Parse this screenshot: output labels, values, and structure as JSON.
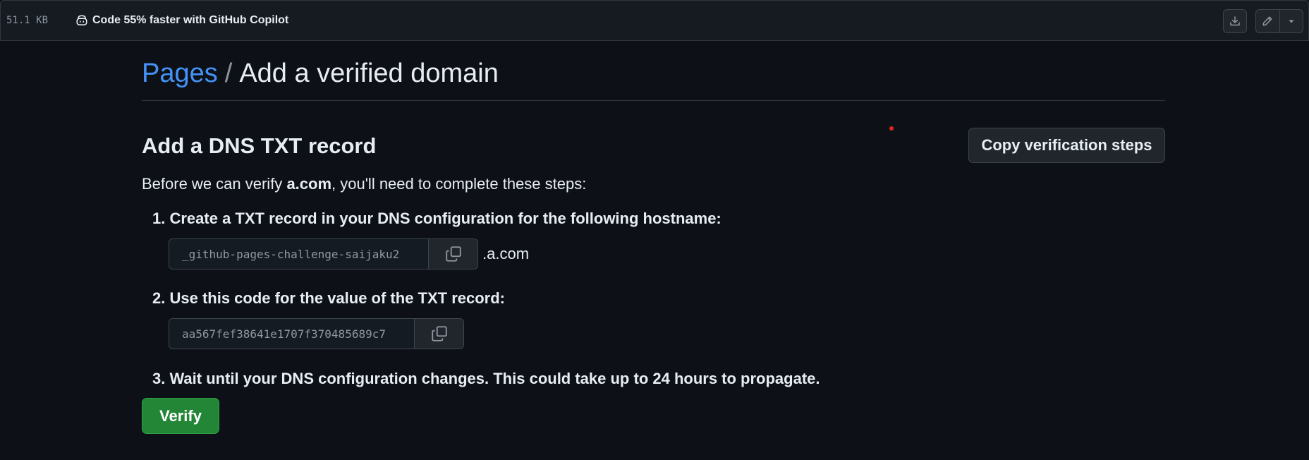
{
  "topbar": {
    "file_size": "51.1 KB",
    "copilot_text": "Code 55% faster with GitHub Copilot",
    "icons": [
      "copilot-icon",
      "download-icon",
      "pencil-icon",
      "triangle-down-icon"
    ]
  },
  "breadcrumb": {
    "parent": "Pages",
    "separator": "/",
    "current": "Add a verified domain"
  },
  "section": {
    "title": "Add a DNS TXT record",
    "copy_steps_label": "Copy verification steps",
    "intro_before": "Before we can verify ",
    "domain": "a.com",
    "intro_after": ", you'll need to complete these steps:"
  },
  "steps": [
    {
      "number": "1.",
      "text": "Create a TXT record in your DNS configuration for the following hostname:",
      "field_value": "_github-pages-challenge-saijaku2",
      "suffix": ".a.com"
    },
    {
      "number": "2.",
      "text": "Use this code for the value of the TXT record:",
      "field_value": "aa567fef38641e1707f370485689c7"
    },
    {
      "number": "3.",
      "text": "Wait until your DNS configuration changes. This could take up to 24 hours to propagate."
    }
  ],
  "verify_label": "Verify",
  "colors": {
    "background": "#0d1117",
    "link": "#4493f8",
    "primary_button": "#238636",
    "text": "#e6edf3"
  }
}
